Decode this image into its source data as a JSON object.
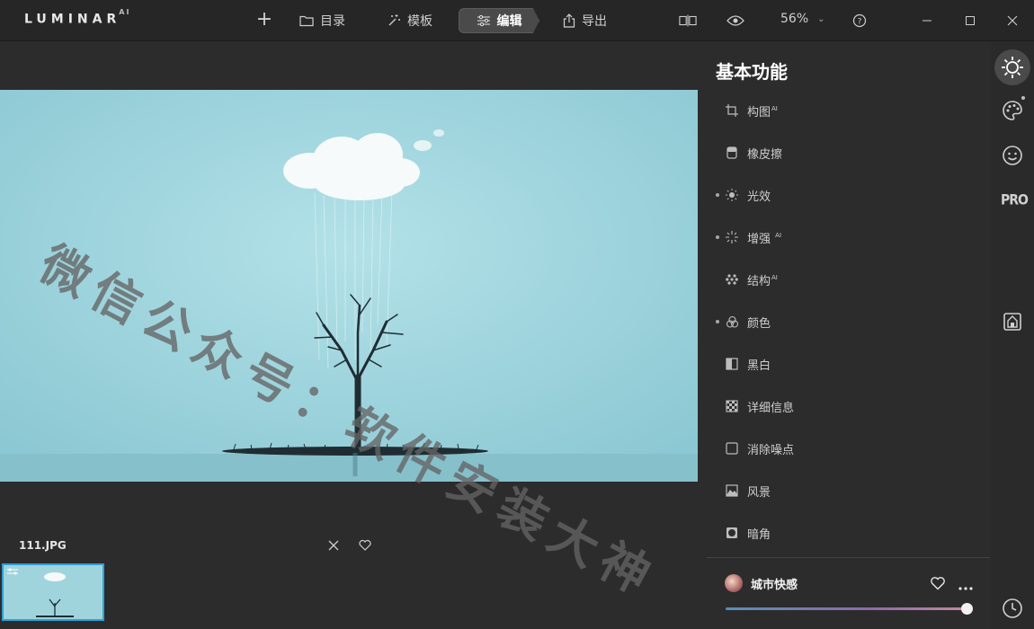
{
  "app": {
    "logo_text": "LUMINAR",
    "logo_superscript": "AI"
  },
  "topbar": {
    "add_label": "+",
    "nav": [
      {
        "label": "目录",
        "icon": "folder-icon"
      },
      {
        "label": "模板",
        "icon": "magic-wand-icon"
      },
      {
        "label": "编辑",
        "icon": "sliders-icon",
        "active": true
      },
      {
        "label": "导出",
        "icon": "share-icon"
      }
    ],
    "zoom": "56%",
    "icons": [
      "compare-icon",
      "eye-icon",
      "help-icon",
      "minimize-icon",
      "maximize-icon",
      "close-icon"
    ]
  },
  "filmstrip": {
    "filename": "111.JPG"
  },
  "panel": {
    "title": "基本功能",
    "tools": [
      {
        "label": "构图",
        "sup": "AI",
        "icon": "crop-icon",
        "dot": false
      },
      {
        "label": "橡皮擦",
        "sup": "",
        "icon": "eraser-icon",
        "dot": false
      },
      {
        "label": "光效",
        "sup": "",
        "icon": "sun-icon",
        "dot": true
      },
      {
        "label": "增强",
        "sup": "AI",
        "icon": "sparkle-icon",
        "dot": true
      },
      {
        "label": "结构",
        "sup": "AI",
        "icon": "structure-icon",
        "dot": false
      },
      {
        "label": "颜色",
        "sup": "",
        "icon": "color-icon",
        "dot": true
      },
      {
        "label": "黑白",
        "sup": "",
        "icon": "bw-icon",
        "dot": false
      },
      {
        "label": "详细信息",
        "sup": "",
        "icon": "detail-icon",
        "dot": false
      },
      {
        "label": "消除噪点",
        "sup": "",
        "icon": "denoise-icon",
        "dot": false
      },
      {
        "label": "风景",
        "sup": "",
        "icon": "landscape-icon",
        "dot": false
      },
      {
        "label": "暗角",
        "sup": "",
        "icon": "vignette-icon",
        "dot": false
      }
    ],
    "preset": {
      "name": "城市快感",
      "amount": 1.0
    }
  },
  "rail": {
    "pro_label": "PRO"
  },
  "watermark": "微信公众号：软件安装大神"
}
